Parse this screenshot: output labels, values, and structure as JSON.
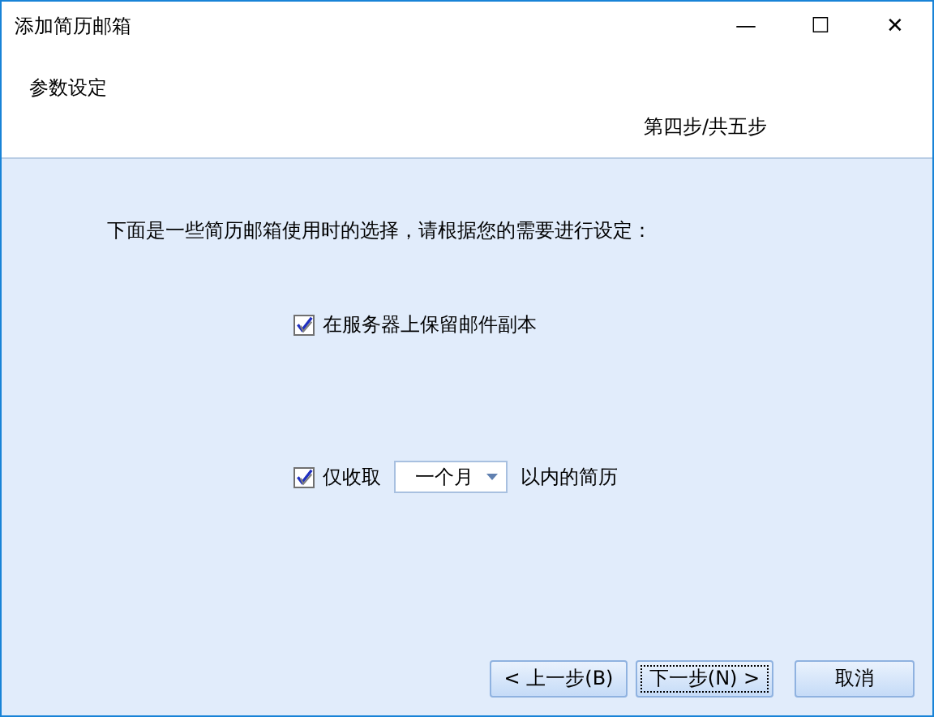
{
  "window": {
    "title": "添加简历邮箱",
    "controls": [
      "—",
      "☐",
      "✕"
    ]
  },
  "header": {
    "subtitle": "参数设定",
    "step": "第四步/共五步"
  },
  "instruction": "下面是一些简历邮箱使用时的选择，请根据您的需要进行设定：",
  "options": [
    {
      "kind": "checkbox",
      "label": "在服务器上保留邮件副本",
      "checked": true
    },
    {
      "kind": "dropdown",
      "label": "仅收取",
      "checked": true,
      "value": "一个月",
      "suffix": "以内的简历"
    }
  ],
  "buttons": [
    {
      "label": "< 上一步(B)",
      "focused": false
    },
    {
      "label": "下一步(N) >",
      "focused": true
    },
    {
      "label": "取消",
      "focused": false
    }
  ]
}
